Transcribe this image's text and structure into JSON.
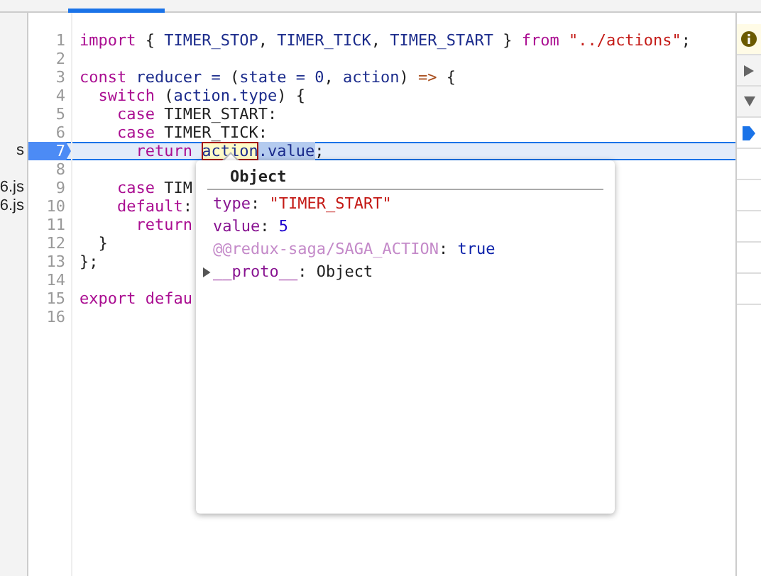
{
  "sidebar": {
    "items": [
      {
        "label": "s"
      },
      {
        "label": "6.js"
      },
      {
        "label": "6.js"
      }
    ]
  },
  "editor": {
    "lines": [
      {
        "number": "1",
        "current": false,
        "tokens": [
          {
            "kind": "keyword",
            "text": "import"
          },
          {
            "kind": "plain",
            "text": " { "
          },
          {
            "kind": "name",
            "text": "TIMER_STOP"
          },
          {
            "kind": "plain",
            "text": ", "
          },
          {
            "kind": "name",
            "text": "TIMER_TICK"
          },
          {
            "kind": "plain",
            "text": ", "
          },
          {
            "kind": "name",
            "text": "TIMER_START"
          },
          {
            "kind": "plain",
            "text": " } "
          },
          {
            "kind": "keyword",
            "text": "from"
          },
          {
            "kind": "string",
            "text": " \"../actions\""
          },
          {
            "kind": "plain",
            "text": ";"
          }
        ]
      },
      {
        "number": "2",
        "current": false
      },
      {
        "number": "3",
        "current": false,
        "tokens": [
          {
            "kind": "keyword",
            "text": "const"
          },
          {
            "kind": "name",
            "text": " reducer"
          },
          {
            "kind": "operator",
            "text": " ="
          },
          {
            "kind": "plain",
            "text": " ("
          },
          {
            "kind": "name",
            "text": "state"
          },
          {
            "kind": "operator",
            "text": " ="
          },
          {
            "kind": "name",
            "text": " 0"
          },
          {
            "kind": "plain",
            "text": ", "
          },
          {
            "kind": "name",
            "text": "action"
          },
          {
            "kind": "plain",
            "text": ") "
          },
          {
            "kind": "arrow",
            "text": "=>"
          },
          {
            "kind": "plain",
            "text": " {"
          }
        ]
      },
      {
        "number": "4",
        "current": false,
        "tokens": [
          {
            "kind": "keyword",
            "text": "  switch"
          },
          {
            "kind": "plain",
            "text": " ("
          },
          {
            "kind": "name",
            "text": "action.type"
          },
          {
            "kind": "plain",
            "text": ") {"
          }
        ]
      },
      {
        "number": "5",
        "current": false,
        "tokens": [
          {
            "kind": "keyword",
            "text": "    case"
          },
          {
            "kind": "plain",
            "text": " TIMER_START:"
          }
        ]
      },
      {
        "number": "6",
        "current": false,
        "tokens": [
          {
            "kind": "keyword",
            "text": "    case"
          },
          {
            "kind": "plain",
            "text": " TIMER_TICK:"
          }
        ]
      },
      {
        "number": "7",
        "current": true,
        "tokens": [
          {
            "kind": "keyword",
            "text": "      return "
          },
          {
            "kind": "hovered",
            "text": "action"
          },
          {
            "kind": "selection",
            "text": ".value"
          },
          {
            "kind": "plain",
            "text": ";"
          }
        ]
      },
      {
        "number": "8",
        "current": false
      },
      {
        "number": "9",
        "current": false,
        "tokens": [
          {
            "kind": "keyword",
            "text": "    case"
          },
          {
            "kind": "plain",
            "text": " TIM"
          }
        ]
      },
      {
        "number": "10",
        "current": false,
        "tokens": [
          {
            "kind": "keyword",
            "text": "    default"
          },
          {
            "kind": "plain",
            "text": ":"
          }
        ]
      },
      {
        "number": "11",
        "current": false,
        "tokens": [
          {
            "kind": "keyword",
            "text": "      return"
          }
        ]
      },
      {
        "number": "12",
        "current": false,
        "tokens": [
          {
            "kind": "plain",
            "text": "  }"
          }
        ]
      },
      {
        "number": "13",
        "current": false,
        "tokens": [
          {
            "kind": "plain",
            "text": "};"
          }
        ]
      },
      {
        "number": "14",
        "current": false
      },
      {
        "number": "15",
        "current": false,
        "tokens": [
          {
            "kind": "keyword",
            "text": "export"
          },
          {
            "kind": "keyword",
            "text": " defau"
          }
        ]
      },
      {
        "number": "16",
        "current": false
      }
    ]
  },
  "popover": {
    "title": "Object",
    "properties": [
      {
        "kind": "own",
        "key": "type",
        "separator": ":",
        "value": {
          "kind": "string",
          "text": "\"TIMER_START\""
        }
      },
      {
        "kind": "own",
        "key": "value",
        "separator": ":",
        "value": {
          "kind": "number",
          "text": "5"
        }
      },
      {
        "kind": "symbol",
        "key": "@@redux-saga/SAGA_ACTION",
        "separator": ":",
        "value": {
          "kind": "boolean",
          "text": "true"
        }
      },
      {
        "kind": "internal",
        "key": "__proto__",
        "separator": ":",
        "expanded": false,
        "value": {
          "kind": "object",
          "text": "Object"
        }
      }
    ]
  }
}
